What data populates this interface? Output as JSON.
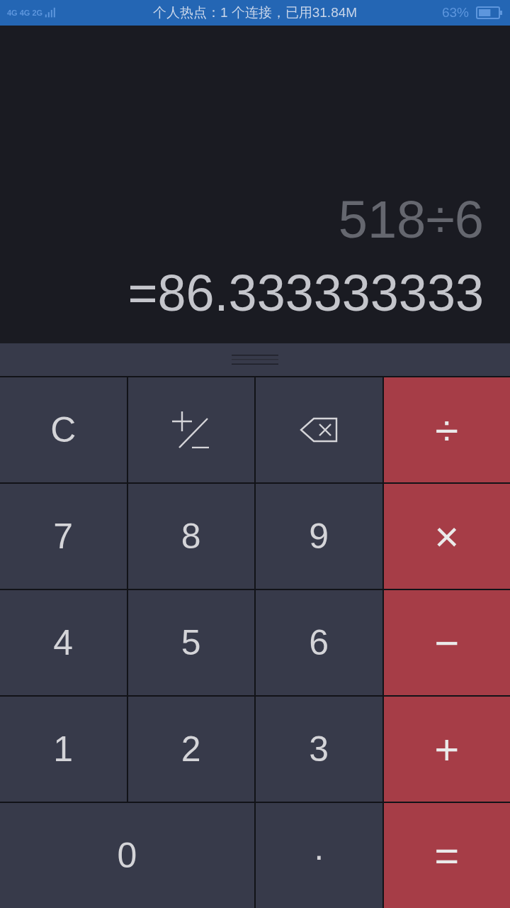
{
  "status_bar": {
    "networks": [
      "4G",
      "4G",
      "2G"
    ],
    "notification": "个人热点：1 个连接，已用31.84M",
    "battery": {
      "text": "63%",
      "level": 0.63
    }
  },
  "display": {
    "expression": "518÷6",
    "result": "=86.333333333"
  },
  "keys": [
    {
      "kind": "text",
      "label": "C",
      "operator": false
    },
    {
      "kind": "plusminus",
      "operator": false
    },
    {
      "kind": "backspace",
      "operator": false
    },
    {
      "kind": "text",
      "label": "÷",
      "operator": true
    },
    {
      "kind": "text",
      "label": "7",
      "operator": false
    },
    {
      "kind": "text",
      "label": "8",
      "operator": false
    },
    {
      "kind": "text",
      "label": "9",
      "operator": false
    },
    {
      "kind": "text",
      "label": "×",
      "operator": true
    },
    {
      "kind": "text",
      "label": "4",
      "operator": false
    },
    {
      "kind": "text",
      "label": "5",
      "operator": false
    },
    {
      "kind": "text",
      "label": "6",
      "operator": false
    },
    {
      "kind": "text",
      "label": "−",
      "operator": true
    },
    {
      "kind": "text",
      "label": "1",
      "operator": false
    },
    {
      "kind": "text",
      "label": "2",
      "operator": false
    },
    {
      "kind": "text",
      "label": "3",
      "operator": false
    },
    {
      "kind": "text",
      "label": "+",
      "operator": true
    },
    {
      "kind": "text",
      "label": "0",
      "operator": false,
      "wide": true
    },
    {
      "kind": "text",
      "label": "·",
      "operator": false
    },
    {
      "kind": "text",
      "label": "=",
      "operator": true
    }
  ]
}
